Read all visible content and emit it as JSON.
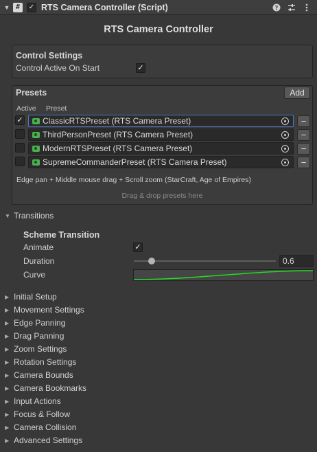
{
  "header": {
    "title": "RTS Camera Controller (Script)",
    "fold_icon": "triangle-down-icon",
    "script_icon": "hash-script-icon",
    "enabled": true,
    "icons": [
      "help-icon",
      "preset-sliders-icon",
      "more-icon"
    ]
  },
  "main_title": "RTS Camera Controller",
  "control_settings": {
    "heading": "Control Settings",
    "active_on_start_label": "Control Active On Start",
    "active_on_start": true
  },
  "presets": {
    "heading": "Presets",
    "add_label": "Add",
    "col_active": "Active",
    "col_preset": "Preset",
    "items": [
      {
        "name": "ClassicRTSPreset (RTS Camera Preset)",
        "active": true
      },
      {
        "name": "ThirdPersonPreset (RTS Camera Preset)",
        "active": false
      },
      {
        "name": "ModernRTSPreset (RTS Camera Preset)",
        "active": false
      },
      {
        "name": "SupremeCommanderPreset (RTS Camera Preset)",
        "active": false
      }
    ],
    "remove_label": "−",
    "description": "Edge pan + Middle mouse drag + Scroll zoom (StarCraft, Age of Empires)",
    "drop_hint": "Drag & drop presets here"
  },
  "transitions": {
    "label": "Transitions",
    "scheme_heading": "Scheme Transition",
    "animate_label": "Animate",
    "animate": true,
    "duration_label": "Duration",
    "duration_value": "0.6",
    "duration_fraction": 0.125,
    "curve_label": "Curve",
    "curve_color": "#22dd22"
  },
  "sections": [
    "Initial Setup",
    "Movement Settings",
    "Edge Panning",
    "Drag Panning",
    "Zoom Settings",
    "Rotation Settings",
    "Camera Bounds",
    "Camera Bookmarks",
    "Input Actions",
    "Focus & Follow",
    "Camera Collision",
    "Advanced Settings"
  ]
}
